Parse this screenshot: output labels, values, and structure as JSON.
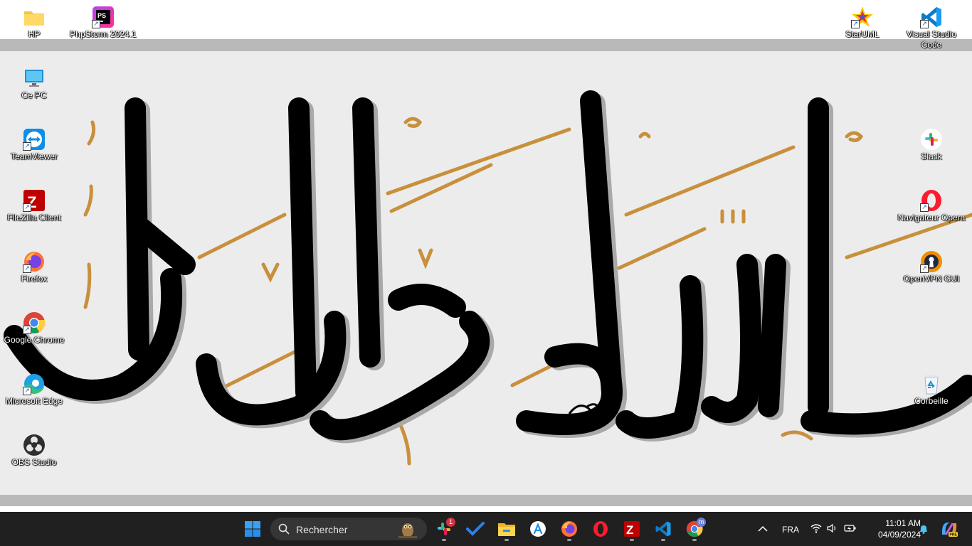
{
  "desktop": {
    "icons": [
      {
        "name": "folder-icon",
        "label": "HP"
      },
      {
        "name": "phpstorm-icon",
        "label": "PhpStorm 2024.1"
      },
      {
        "name": "this-pc-icon",
        "label": "Ce PC"
      },
      {
        "name": "teamviewer-icon",
        "label": "TeamViewer"
      },
      {
        "name": "filezilla-icon",
        "label": "FileZilla Client"
      },
      {
        "name": "firefox-icon",
        "label": "Firefox"
      },
      {
        "name": "chrome-icon",
        "label": "Google Chrome"
      },
      {
        "name": "edge-icon",
        "label": "Microsoft Edge"
      },
      {
        "name": "obs-icon",
        "label": "OBS Studio"
      },
      {
        "name": "staruml-icon",
        "label": "StarUML"
      },
      {
        "name": "vscode-icon",
        "label": "Visual Studio Code"
      },
      {
        "name": "slack-icon",
        "label": "Slack"
      },
      {
        "name": "opera-icon",
        "label": "Navigateur Opera"
      },
      {
        "name": "openvpn-icon",
        "label": "OpenVPN GUI"
      },
      {
        "name": "recycle-bin-icon",
        "label": "Corbeille"
      }
    ]
  },
  "wallpaper": {
    "description_color_black": "#000000",
    "accent_gold": "#c8903c"
  },
  "taskbar": {
    "search_placeholder": "Rechercher",
    "slack_badge": "1",
    "chrome_badge": "m",
    "language": "FRA",
    "time": "11:01 AM",
    "date": "04/09/2024"
  }
}
